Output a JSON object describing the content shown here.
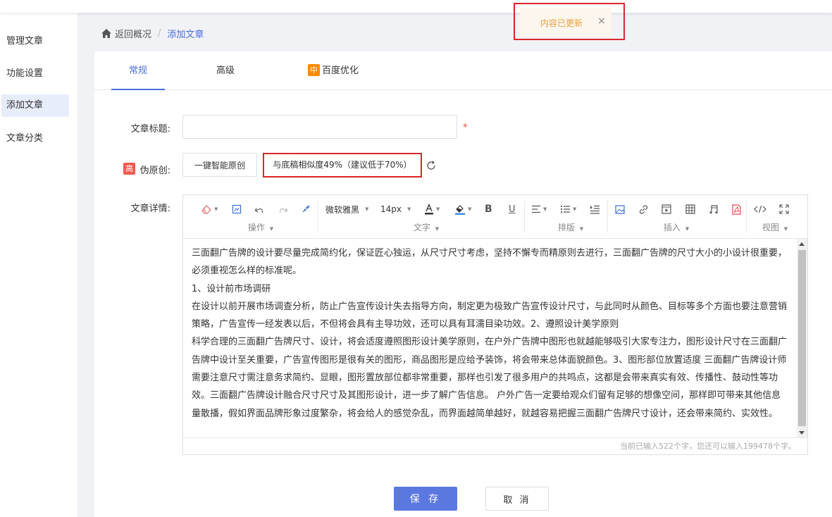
{
  "toast": {
    "message": "内容已更新",
    "close_symbol": "×"
  },
  "sidebar": {
    "items": [
      {
        "label": "管理文章"
      },
      {
        "label": "功能设置"
      },
      {
        "label": "添加文章"
      },
      {
        "label": "文章分类"
      }
    ]
  },
  "breadcrumb": {
    "back": "返回概况",
    "separator": "/",
    "current": "添加文章"
  },
  "tabs": [
    {
      "label": "常规"
    },
    {
      "label": "高级"
    },
    {
      "badge": "中",
      "label": "百度优化"
    }
  ],
  "form": {
    "title_label": "文章标题:",
    "title_value": "",
    "required_mark": "*",
    "rewrite_badge": "高",
    "rewrite_label": "伪原创:",
    "rewrite_button": "一键智能原创",
    "similarity_text": "与底稿相似度49%（建议低于70%）",
    "detail_label": "文章详情:"
  },
  "editor": {
    "toolbar": {
      "font_family": "微软雅黑",
      "font_size": "14px",
      "bold": "B",
      "underline": "U",
      "groups": [
        "操作",
        "文字",
        "排版",
        "插入",
        "视图"
      ]
    },
    "paragraphs": [
      "三面翻广告牌的设计要尽量完成简约化，保证匠心独运，从尺寸尺寸考虑，坚持不懈专而精原则去进行，三面翻广告牌的尺寸大小的小设计很重要，必须重视怎么样的标准呢。",
      "1、设计前市场调研",
      "在设计以前开展市场调查分析，防止广告宣传设计失去指导方向，制定更为极致广告宣传设计尺寸，与此同时从颜色、目标等多个方面也要注意营销策略，广告宣传一经发表以后，不但将会具有主导功效，还可以具有耳濡目染功效。2、遵照设计美学原则",
      "科学合理的三面翻广告牌尺寸、设计，将会适度遵照图形设计美学原则，在户外广告牌中图形也就越能够吸引大家专注力，图形设计尺寸在三面翻广告牌中设计至关重要，广告宣传图形是很有关的图形，商品图形是应给予装饰，将会带来总体面貌颜色。3、图形部位放置适度 三面翻广告牌设计师需要注意尺寸需注意务求简约、显眼，图形置放部位都非常重要，那样也引发了很多用户的共鸣点，这都是会带来真实有效、传播性、鼓动性等功效。三面翻广告牌设计融合尺寸尺寸及其图形设计，进一步了解广告信息。 户外广告一定要给观众们留有足够的想像空间，那样即可带来其他信息量散播，假如界面品牌形象过度繁杂，将会给人的感觉杂乱，而界面越简单越好，就越容易把握三面翻广告牌尺寸设计，还会带来简约、实效性。"
    ],
    "footer": "当前已输入522个字，您还可以输入199478个字。"
  },
  "actions": {
    "save": "保 存",
    "cancel": "取 消"
  },
  "colors": {
    "accent": "#4a6ee0",
    "warning_bg": "#fdf6ec",
    "warning_text": "#e6a23c",
    "highlight_border": "#d9262b",
    "badge_orange": "#ff8a00",
    "badge_red": "#f05b4f"
  }
}
